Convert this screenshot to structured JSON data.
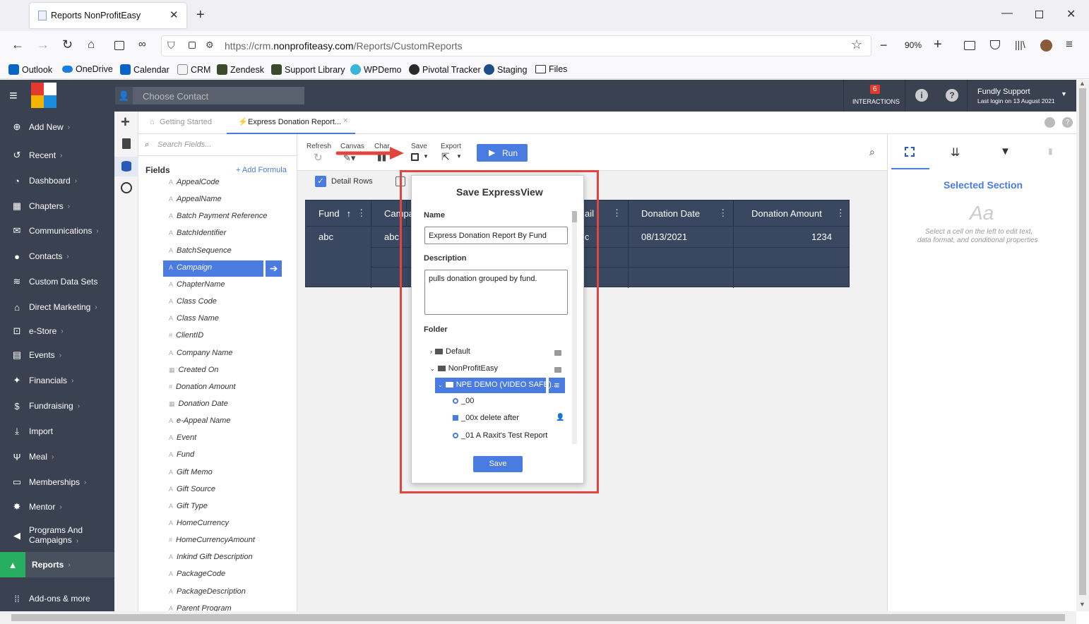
{
  "browser": {
    "tab_title": "Reports NonProfitEasy",
    "url_prefix": "https://crm.",
    "url_domain": "nonprofiteasy.com",
    "url_path": "/Reports/CustomReports",
    "zoom": "90%",
    "bookmarks": [
      "Outlook",
      "OneDrive",
      "Calendar",
      "CRM",
      "Zendesk",
      "Support Library",
      "WPDemo",
      "Pivotal Tracker",
      "Staging",
      "Files"
    ]
  },
  "header": {
    "contact_placeholder": "Choose Contact",
    "interactions_count": "6",
    "interactions_label": "INTERACTIONS",
    "user_name": "Fundly Support",
    "last_login": "Last login on 13 August 2021"
  },
  "sidebar": {
    "items": [
      {
        "label": "Add New",
        "icon": "plus-circle-icon"
      },
      {
        "label": "Recent",
        "icon": "history-icon"
      },
      {
        "label": "Dashboard",
        "icon": "dashboard-icon"
      },
      {
        "label": "Chapters",
        "icon": "grid-icon"
      },
      {
        "label": "Communications",
        "icon": "envelope-icon"
      },
      {
        "label": "Contacts",
        "icon": "user-icon"
      },
      {
        "label": "Custom Data Sets",
        "icon": "database-icon"
      },
      {
        "label": "Direct Marketing",
        "icon": "bank-icon"
      },
      {
        "label": "e-Store",
        "icon": "cart-icon"
      },
      {
        "label": "Events",
        "icon": "calendar-icon"
      },
      {
        "label": "Financials",
        "icon": "handshake-icon"
      },
      {
        "label": "Fundraising",
        "icon": "money-bag-icon"
      },
      {
        "label": "Import",
        "icon": "download-icon"
      },
      {
        "label": "Meal",
        "icon": "utensils-icon"
      },
      {
        "label": "Memberships",
        "icon": "id-card-icon"
      },
      {
        "label": "Mentor",
        "icon": "mentor-icon"
      },
      {
        "label": "Programs And",
        "label2": "Campaigns",
        "icon": "megaphone-icon"
      },
      {
        "label": "Reports",
        "icon": "chart-icon"
      },
      {
        "label": "Add-ons & more",
        "icon": "apps-icon"
      }
    ]
  },
  "tabs": {
    "getting_started": "Getting Started",
    "express_report": "Express Donation Report..."
  },
  "fields_panel": {
    "search_placeholder": "Search Fields...",
    "title": "Fields",
    "add_formula": "+ Add Formula",
    "fields": [
      "AppealCode",
      "AppealName",
      "Batch Payment Reference",
      "BatchIdentifier",
      "BatchSequence",
      "Campaign",
      "ChapterName",
      "Class Code",
      "Class Name",
      "ClientID",
      "Company Name",
      "Created On",
      "Donation Amount",
      "Donation Date",
      "e-Appeal Name",
      "Event",
      "Fund",
      "Gift Memo",
      "Gift Source",
      "Gift Type",
      "HomeCurrency",
      "HomeCurrencyAmount",
      "Inkind Gift Description",
      "PackageCode",
      "PackageDescription",
      "Parent Program"
    ],
    "selected": "Campaign"
  },
  "toolbar": {
    "refresh": "Refresh",
    "canvas": "Canvas",
    "chart": "Char",
    "save": "Save",
    "export": "Export",
    "run": "Run",
    "detail_rows": "Detail Rows"
  },
  "grid": {
    "headers": [
      "Fund",
      "Campa",
      "ail",
      "Donation Date",
      "Donation Amount"
    ],
    "row": [
      "abc",
      "abc",
      "c",
      "08/13/2021",
      "1234"
    ]
  },
  "dialog": {
    "title": "Save ExpressView",
    "name_label": "Name",
    "name_value": "Express Donation Report By Fund",
    "description_label": "Description",
    "description_value": "pulls donation grouped by fund.",
    "folder_label": "Folder",
    "folders": {
      "default": "Default",
      "npe": "NonProfitEasy",
      "demo": "NPE DEMO (VIDEO SAFE)...",
      "item1": "_00",
      "item2": "_00x delete after",
      "item3": "_01 A Raxit's Test Report"
    },
    "save_button": "Save"
  },
  "right_panel": {
    "title": "Selected Section",
    "aa": "Aa",
    "hint1": "Select a cell on the left to edit text,",
    "hint2": "data format, and conditional properties"
  },
  "colors": {
    "sidebar": "#3a4150",
    "accent": "#4a7be0",
    "grid": "#3a4760",
    "highlight": "#e0463e"
  }
}
